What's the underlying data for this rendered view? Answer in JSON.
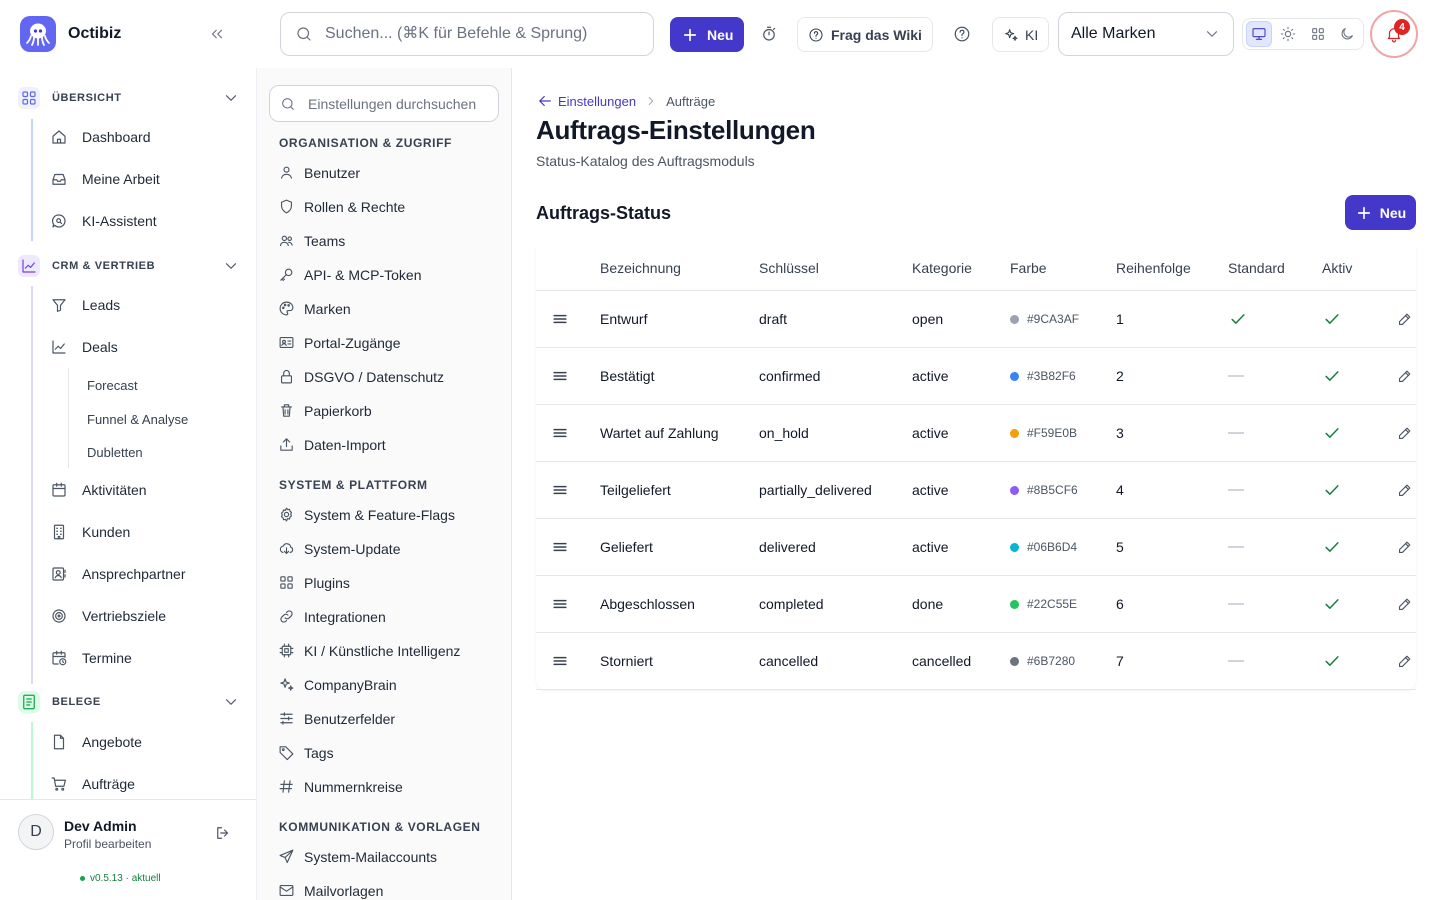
{
  "app": {
    "name": "Octibiz"
  },
  "topbar": {
    "search_placeholder": "Suchen... (⌘K für Befehle & Sprung)",
    "new_label": "Neu",
    "wiki_label": "Frag das Wiki",
    "ki_label": "KI",
    "brand_select": "Alle Marken",
    "notification_count": "4"
  },
  "sidebar": {
    "sections": [
      {
        "label": "ÜBERSICHT",
        "icon": "grid-icon",
        "color": "#6366f1"
      },
      {
        "label": "CRM & VERTRIEB",
        "icon": "chart-icon",
        "color": "#7c3aed"
      },
      {
        "label": "BELEGE",
        "icon": "receipt-icon",
        "color": "#16a34a"
      }
    ],
    "items": [
      {
        "label": "Dashboard",
        "icon": "home-icon"
      },
      {
        "label": "Meine Arbeit",
        "icon": "inbox-icon"
      },
      {
        "label": "KI-Assistent",
        "icon": "chat-search-icon"
      },
      {
        "label": "Leads",
        "icon": "funnel-icon"
      },
      {
        "label": "Deals",
        "icon": "trend-icon"
      },
      {
        "label": "Aktivitäten",
        "icon": "calendar-icon"
      },
      {
        "label": "Kunden",
        "icon": "building-icon"
      },
      {
        "label": "Ansprechpartner",
        "icon": "contact-icon"
      },
      {
        "label": "Vertriebsziele",
        "icon": "target-icon"
      },
      {
        "label": "Termine",
        "icon": "calendar-clock-icon"
      },
      {
        "label": "Angebote",
        "icon": "document-icon"
      },
      {
        "label": "Aufträge",
        "icon": "cart-icon"
      }
    ],
    "subitems": [
      "Forecast",
      "Funnel & Analyse",
      "Dubletten"
    ],
    "user": {
      "initial": "D",
      "name": "Dev Admin",
      "sub": "Profil bearbeiten"
    },
    "version": "v0.5.13 · aktuell"
  },
  "settings_nav": {
    "search_placeholder": "Einstellungen durchsuchen",
    "groups": [
      {
        "title": "ORGANISATION & ZUGRIFF",
        "items": [
          "Benutzer",
          "Rollen & Rechte",
          "Teams",
          "API- & MCP-Token",
          "Marken",
          "Portal-Zugänge",
          "DSGVO / Datenschutz",
          "Papierkorb",
          "Daten-Import"
        ]
      },
      {
        "title": "SYSTEM & PLATTFORM",
        "items": [
          "System & Feature-Flags",
          "System-Update",
          "Plugins",
          "Integrationen",
          "KI / Künstliche Intelligenz",
          "CompanyBrain",
          "Benutzerfelder",
          "Tags",
          "Nummernkreise"
        ]
      },
      {
        "title": "KOMMUNIKATION & VORLAGEN",
        "items": [
          "System-Mailaccounts",
          "Mailvorlagen"
        ]
      }
    ]
  },
  "main": {
    "breadcrumb": {
      "parent": "Einstellungen",
      "current": "Aufträge"
    },
    "title": "Auftrags-Einstellungen",
    "subtitle": "Status-Katalog des Auftragsmoduls",
    "section_title": "Auftrags-Status",
    "new_label": "Neu",
    "columns": [
      "Bezeichnung",
      "Schlüssel",
      "Kategorie",
      "Farbe",
      "Reihenfolge",
      "Standard",
      "Aktiv"
    ],
    "rows": [
      {
        "name": "Entwurf",
        "key": "draft",
        "category": "open",
        "color": "#9CA3AF",
        "order": "1",
        "standard": true,
        "active": true
      },
      {
        "name": "Bestätigt",
        "key": "confirmed",
        "category": "active",
        "color": "#3B82F6",
        "order": "2",
        "standard": false,
        "active": true
      },
      {
        "name": "Wartet auf Zahlung",
        "key": "on_hold",
        "category": "active",
        "color": "#F59E0B",
        "order": "3",
        "standard": false,
        "active": true
      },
      {
        "name": "Teilgeliefert",
        "key": "partially_delivered",
        "category": "active",
        "color": "#8B5CF6",
        "order": "4",
        "standard": false,
        "active": true
      },
      {
        "name": "Geliefert",
        "key": "delivered",
        "category": "active",
        "color": "#06B6D4",
        "order": "5",
        "standard": false,
        "active": true
      },
      {
        "name": "Abgeschlossen",
        "key": "completed",
        "category": "done",
        "color": "#22C55E",
        "order": "6",
        "standard": false,
        "active": true
      },
      {
        "name": "Storniert",
        "key": "cancelled",
        "category": "cancelled",
        "color": "#6B7280",
        "order": "7",
        "standard": false,
        "active": true
      }
    ]
  }
}
